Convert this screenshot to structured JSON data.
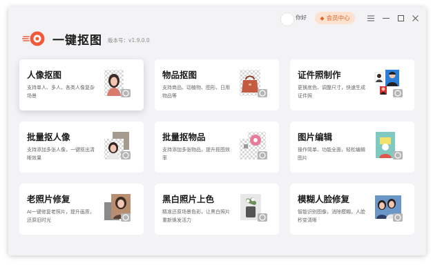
{
  "header": {
    "user_name": "你好",
    "vip_label": "会员中心",
    "app_title": "一键抠图",
    "version": "版本号：v1.9.0.0"
  },
  "colors": {
    "accent": "#ef5a3c",
    "vip_bg": "#fde3cf",
    "vip_text": "#e0642b",
    "window_bg": "#f3f3f5",
    "card_bg": "#ffffff"
  },
  "features": [
    {
      "title": "人像抠图",
      "desc": "支持单人、多人、各类人像复杂场景"
    },
    {
      "title": "物品抠图",
      "desc": "支持商品、动植物、图形、日用物品等"
    },
    {
      "title": "证件照制作",
      "desc": "更换底色、调整尺寸，快速生成证件照"
    },
    {
      "title": "批量抠人像",
      "desc": "支持添加多张人像，一键抠出清晰效果"
    },
    {
      "title": "批量抠物品",
      "desc": "支持添加多张物品，提升抠图效率"
    },
    {
      "title": "图片编辑",
      "desc": "操作简单、功能全面，轻松编辑图片"
    },
    {
      "title": "老照片修复",
      "desc": "AI一键修复老照片，提升画质，还原旧时光"
    },
    {
      "title": "黑白照片上色",
      "desc": "精准还原场景色彩，让黑白照片重新焕发活力"
    },
    {
      "title": "模糊人脸修复",
      "desc": "智能识别图像，消除模糊，人脸秒变清晰"
    }
  ]
}
